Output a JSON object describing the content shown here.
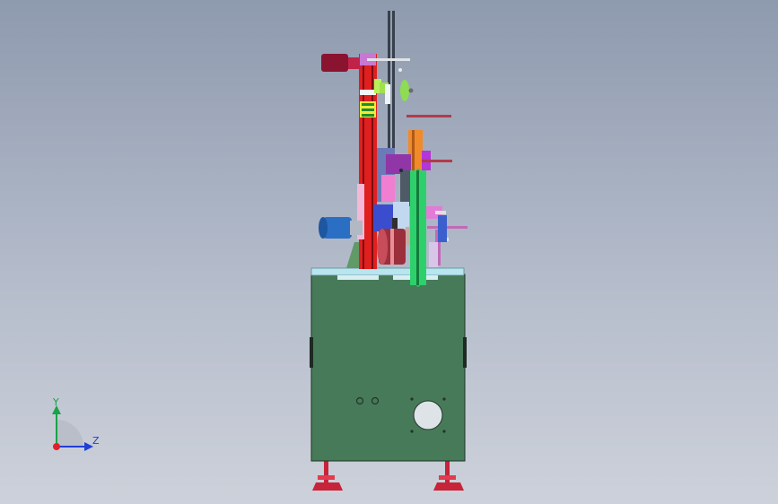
{
  "viewport": {
    "background_top": "#8e9aae",
    "background_bottom": "#cdd1da"
  },
  "model": {
    "colors": {
      "cabinet": "#477a58",
      "table_top": "#b9e6ee",
      "feet": "#c7243a",
      "frame_red": "#e01f1f",
      "motor_maroon": "#8a1430",
      "motor_blue": "#2a6fc4",
      "wheel_green": "#24c062",
      "accent_orange": "#f08a2a",
      "accent_purple": "#b436d6",
      "accent_pink": "#f07fd2"
    }
  },
  "triad": {
    "y_label": "Y",
    "z_label": "Z",
    "y_color": "#17a34a",
    "z_color": "#1f3fd6",
    "origin_color": "#e0202a"
  }
}
